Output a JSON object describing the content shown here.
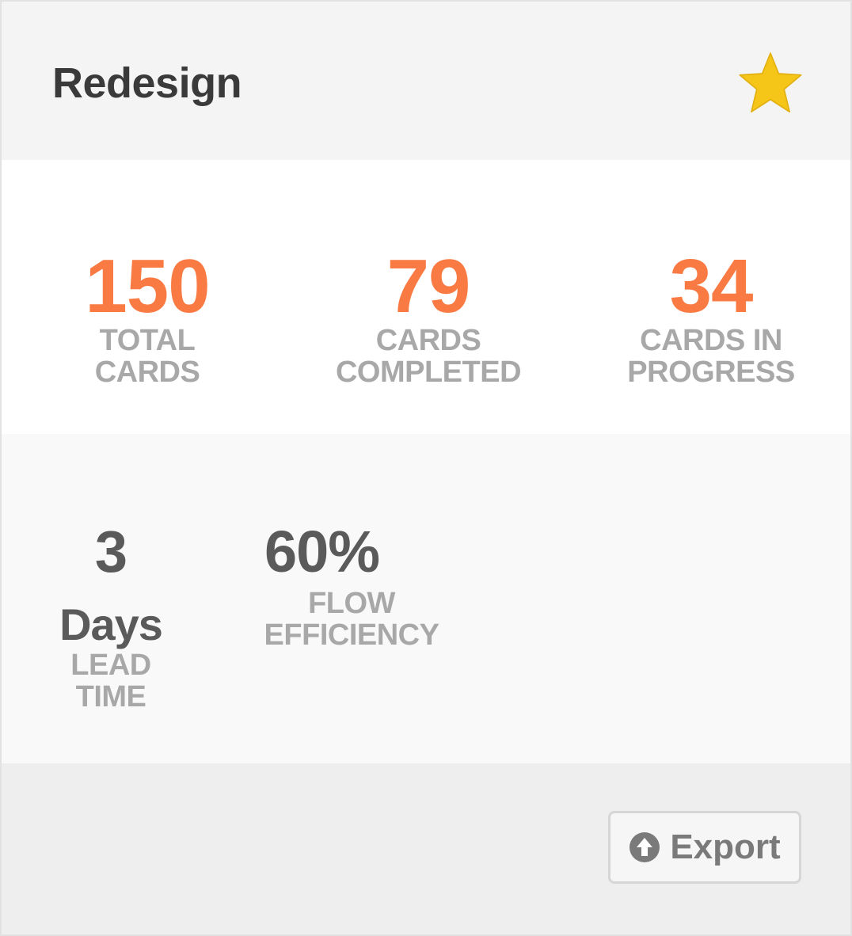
{
  "card": {
    "title": "Redesign",
    "favorite_icon": "star-icon",
    "favorite_color": "#f5c518"
  },
  "stats_primary": [
    {
      "value": "150",
      "label_lines": [
        "TOTAL",
        "CARDS"
      ]
    },
    {
      "value": "79",
      "label_lines": [
        "CARDS",
        "COMPLETED"
      ]
    },
    {
      "value": "34",
      "label_lines": [
        "CARDS IN",
        "PROGRESS"
      ]
    }
  ],
  "stats_secondary": {
    "lead_time": {
      "value": "3",
      "unit": "Days",
      "label_lines": [
        "LEAD",
        "TIME"
      ]
    },
    "flow_efficiency": {
      "value": "60%",
      "label_lines": [
        "FLOW",
        "EFFICIENCY"
      ]
    }
  },
  "footer": {
    "export_label": "Export",
    "export_icon": "upload-circle-icon"
  },
  "colors": {
    "accent": "#f97a43",
    "label_gray": "#a8a8a8",
    "value_gray": "#5a5a5a"
  }
}
